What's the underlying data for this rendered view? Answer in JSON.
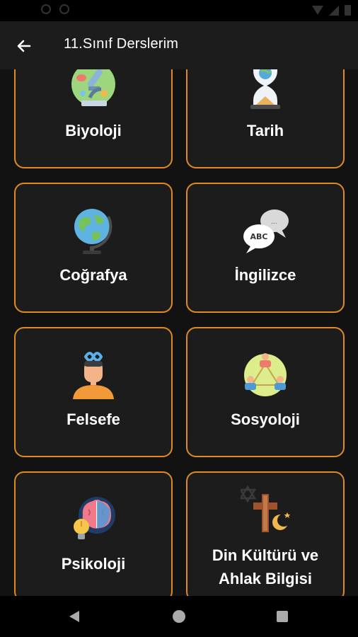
{
  "app_bar": {
    "title": "11.Sınıf Derslerim",
    "back_icon": "arrow-left-icon"
  },
  "theme": {
    "accent": "#e18a21",
    "card_bg": "#1c1c1c",
    "background": "#121212"
  },
  "subjects": [
    {
      "label": "Biyoloji",
      "icon": "microscope-icon"
    },
    {
      "label": "Tarih",
      "icon": "hourglass-icon"
    },
    {
      "label": "Coğrafya",
      "icon": "globe-icon"
    },
    {
      "label": "İngilizce",
      "icon": "speech-bubbles-icon"
    },
    {
      "label": "Felsefe",
      "icon": "thinker-icon"
    },
    {
      "label": "Sosyoloji",
      "icon": "group-network-icon"
    },
    {
      "label": "Psikoloji",
      "icon": "brain-lightbulb-icon"
    },
    {
      "label": "Din Kültürü ve Ahlak Bilgisi",
      "icon": "religion-symbols-icon"
    }
  ],
  "icons_text": {
    "abc": "ABC"
  },
  "nav": {
    "back": "nav-back-icon",
    "home": "nav-home-icon",
    "recents": "nav-recents-icon"
  }
}
